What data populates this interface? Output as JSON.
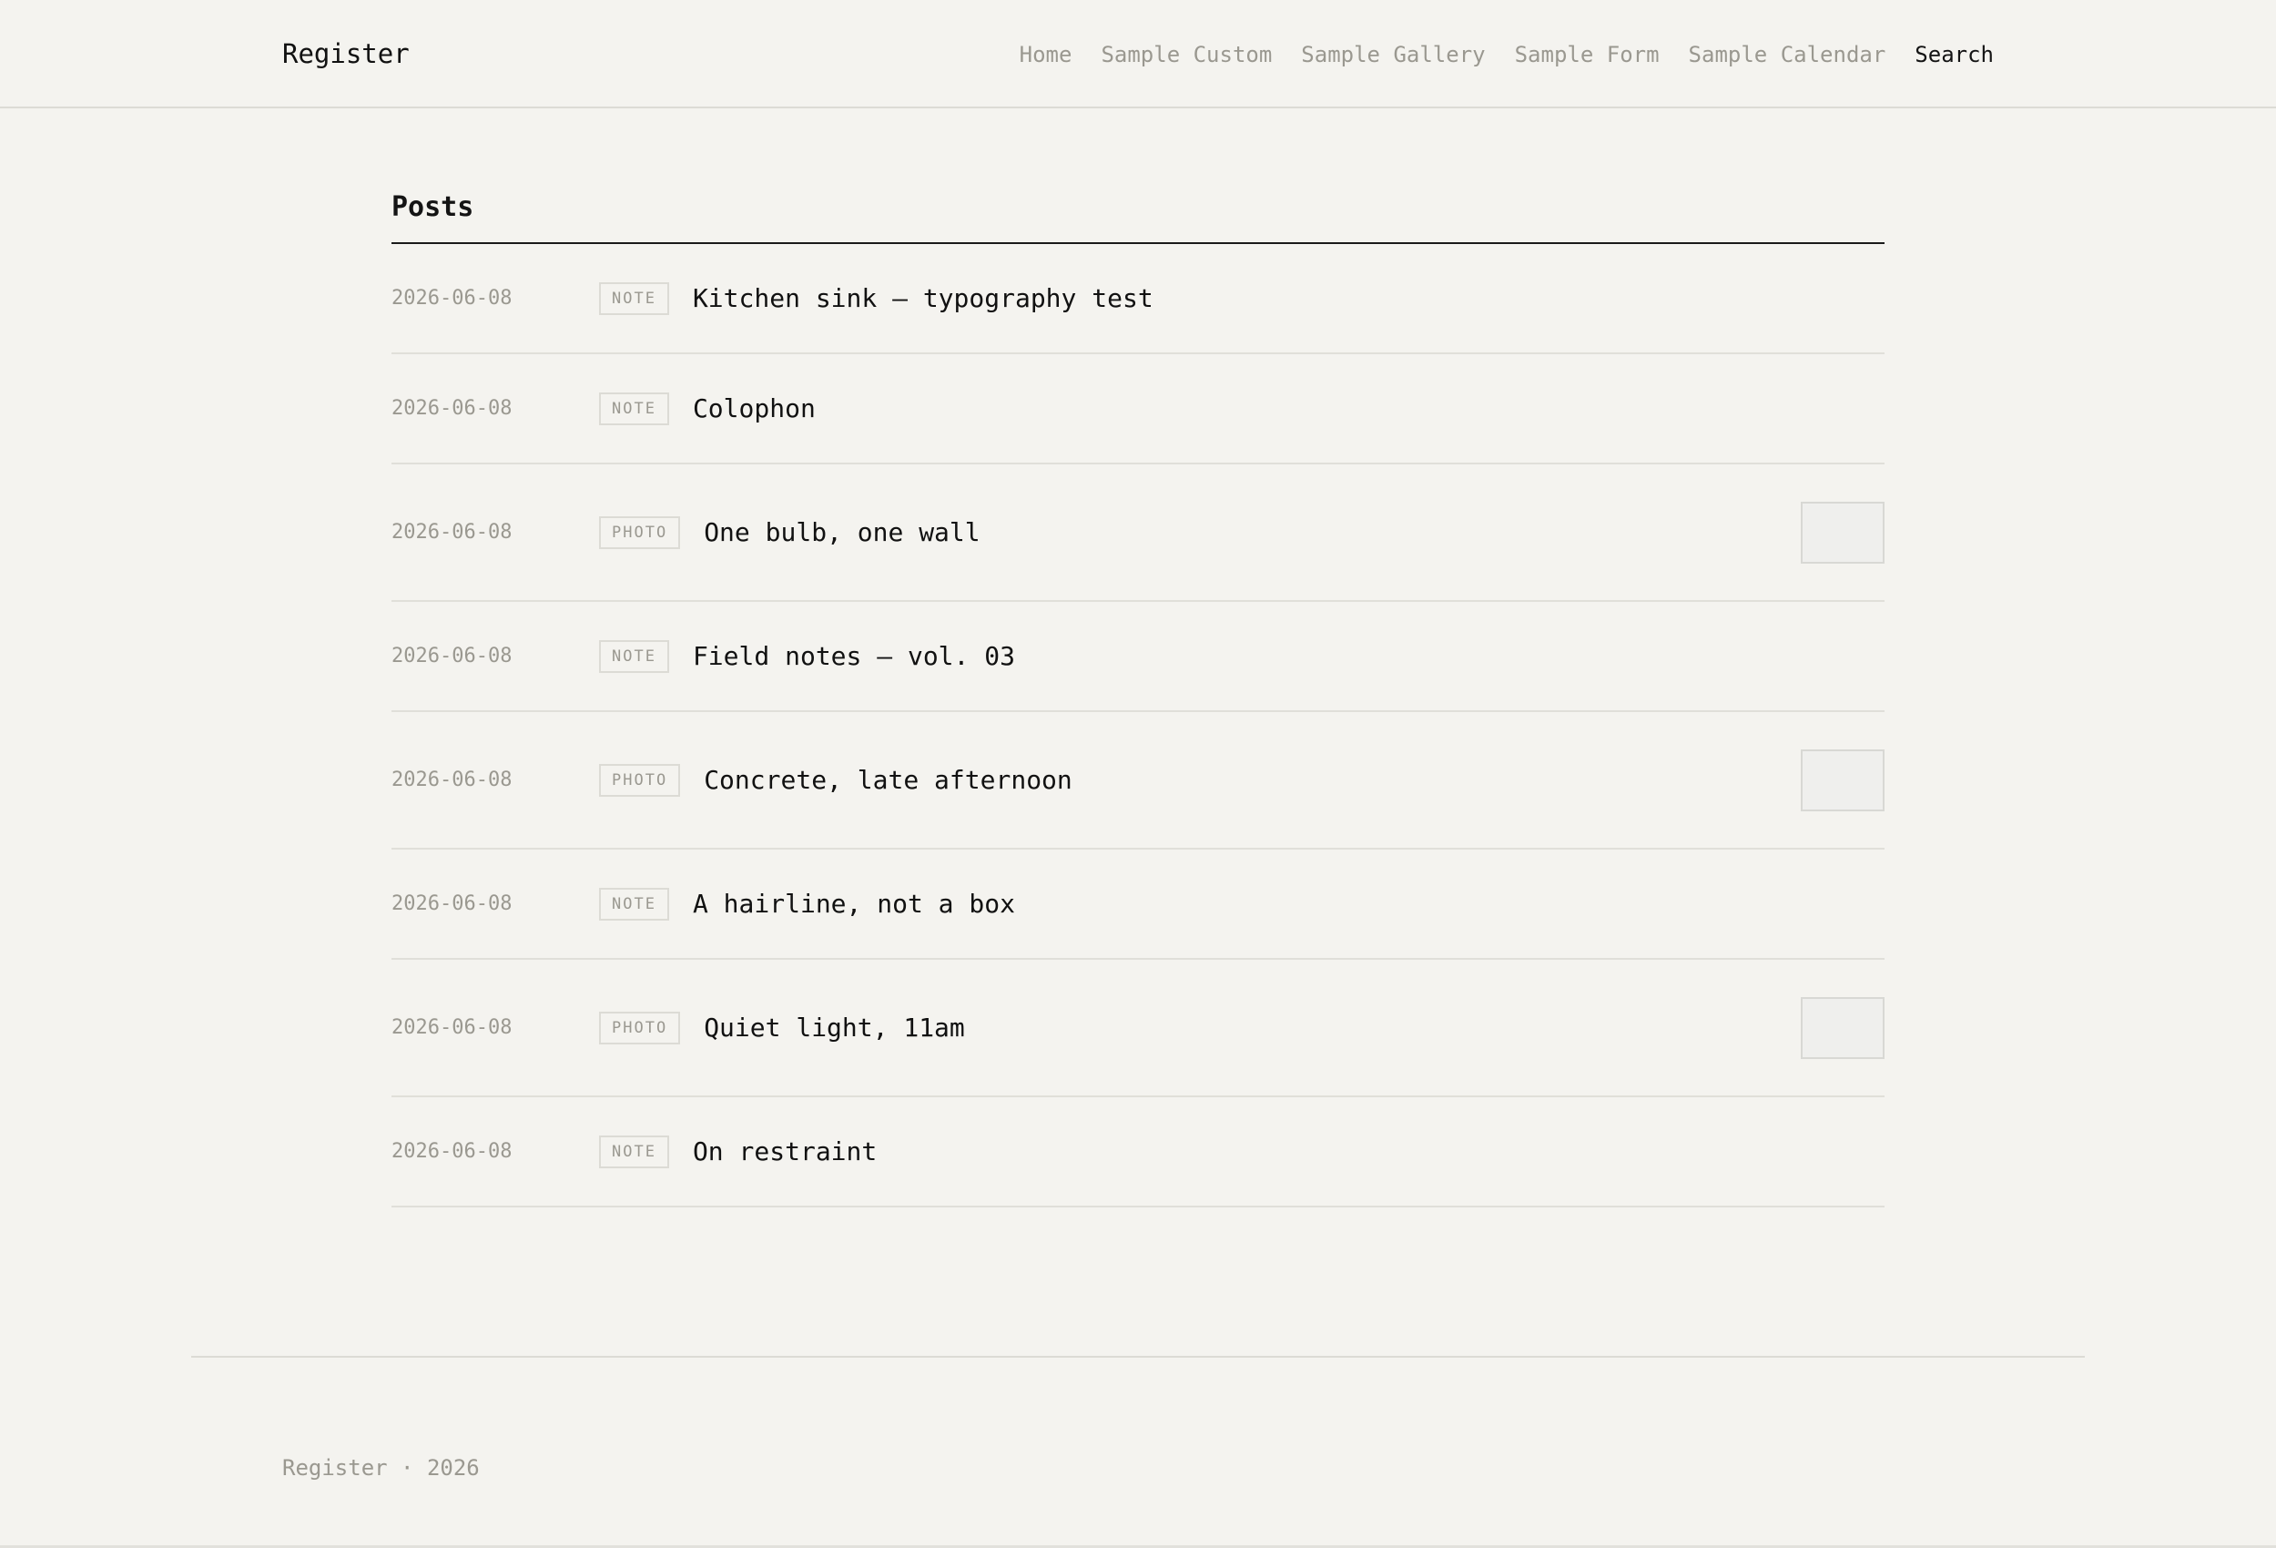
{
  "header": {
    "brand": "Register",
    "nav": [
      {
        "label": "Home"
      },
      {
        "label": "Sample Custom"
      },
      {
        "label": "Sample Gallery"
      },
      {
        "label": "Sample Form"
      },
      {
        "label": "Sample Calendar"
      },
      {
        "label": "Search"
      }
    ]
  },
  "main": {
    "section_title": "Posts",
    "posts": [
      {
        "date": "2026-06-08",
        "kind": "NOTE",
        "title": "Kitchen sink — typography test"
      },
      {
        "date": "2026-06-08",
        "kind": "NOTE",
        "title": "Colophon"
      },
      {
        "date": "2026-06-08",
        "kind": "PHOTO",
        "title": "One bulb, one wall"
      },
      {
        "date": "2026-06-08",
        "kind": "NOTE",
        "title": "Field notes — vol. 03"
      },
      {
        "date": "2026-06-08",
        "kind": "PHOTO",
        "title": "Concrete, late afternoon"
      },
      {
        "date": "2026-06-08",
        "kind": "NOTE",
        "title": "A hairline, not a box"
      },
      {
        "date": "2026-06-08",
        "kind": "PHOTO",
        "title": "Quiet light, 11am"
      },
      {
        "date": "2026-06-08",
        "kind": "NOTE",
        "title": "On restraint"
      }
    ]
  },
  "footer": {
    "text": "Register · 2026"
  }
}
